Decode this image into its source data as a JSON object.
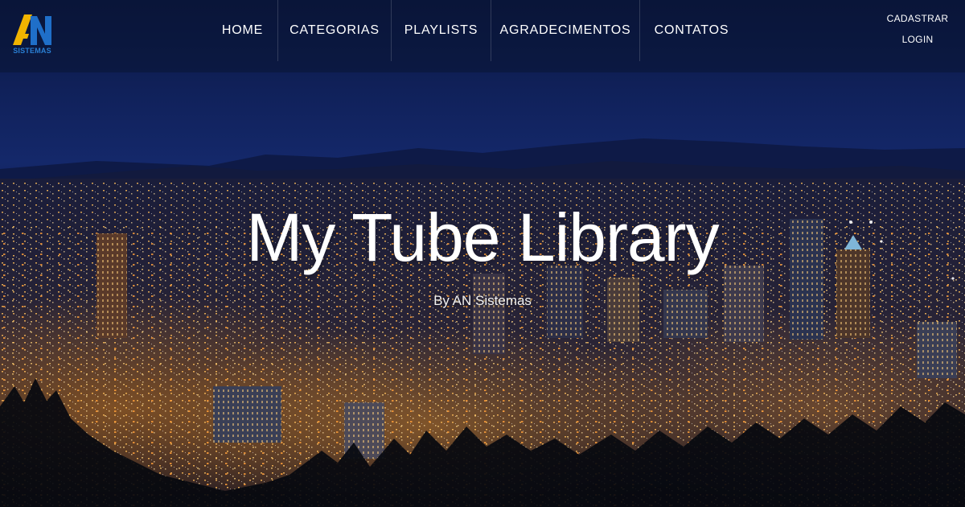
{
  "brand": {
    "logo_letters": "AN",
    "logo_caption": "SISTEMAS"
  },
  "nav": {
    "items": [
      {
        "label": "HOME"
      },
      {
        "label": "CATEGORIAS"
      },
      {
        "label": "PLAYLISTS"
      },
      {
        "label": "AGRADECIMENTOS"
      },
      {
        "label": "CONTATOS"
      }
    ]
  },
  "auth": {
    "register_label": "CADASTRAR",
    "login_label": "LOGIN"
  },
  "hero": {
    "title": "My Tube Library",
    "subtitle": "By AN Sistemas",
    "background": "night-city-skyline"
  },
  "colors": {
    "sky_top": "#0d1b4a",
    "sky_bottom": "#12255e",
    "logo_yellow": "#f2b400",
    "logo_blue": "#1f6fc9",
    "city_light": "#ffb347"
  }
}
